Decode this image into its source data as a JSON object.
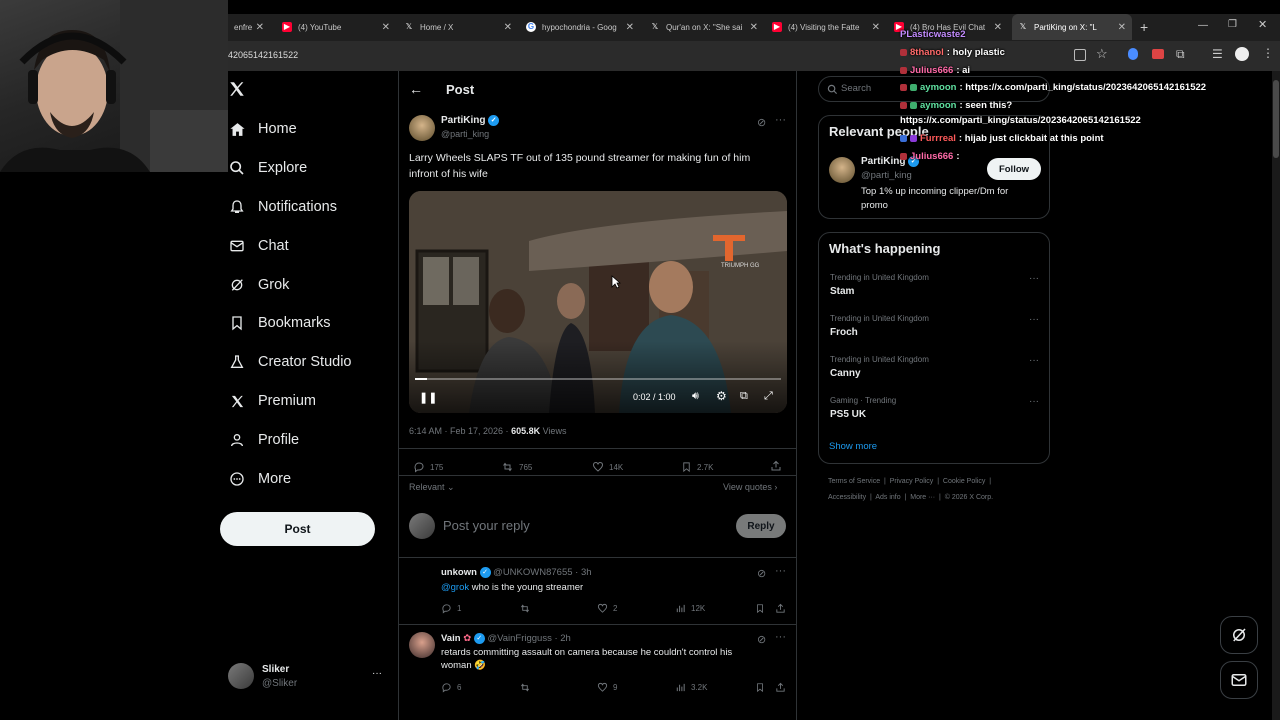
{
  "browser": {
    "tabs": [
      {
        "title": "enfre",
        "icon": "page-icon"
      },
      {
        "title": "(4) YouTube",
        "icon": "youtube-icon"
      },
      {
        "title": "Home / X",
        "icon": "x-logo-icon"
      },
      {
        "title": "hypochondria - Goog",
        "icon": "google-icon"
      },
      {
        "title": "Qur'an on X: \"She sai",
        "icon": "x-logo-icon"
      },
      {
        "title": "(4) Visiting the Fatte",
        "icon": "youtube-icon"
      },
      {
        "title": "(4) Bro Has Evil Chat",
        "icon": "youtube-icon"
      },
      {
        "title": "PartiKing on X: \"L",
        "icon": "x-logo-icon"
      }
    ],
    "new_tab_label": "+",
    "address": "42065142161522"
  },
  "nav": {
    "items": [
      {
        "label": "Home",
        "icon": "home-icon"
      },
      {
        "label": "Explore",
        "icon": "search-icon"
      },
      {
        "label": "Notifications",
        "icon": "bell-icon"
      },
      {
        "label": "Chat",
        "icon": "mail-icon"
      },
      {
        "label": "Grok",
        "icon": "grok-icon"
      },
      {
        "label": "Bookmarks",
        "icon": "bookmark-icon"
      },
      {
        "label": "Creator Studio",
        "icon": "flask-icon"
      },
      {
        "label": "Premium",
        "icon": "x-logo-icon"
      },
      {
        "label": "Profile",
        "icon": "person-icon"
      },
      {
        "label": "More",
        "icon": "more-circle-icon"
      }
    ],
    "post_label": "Post",
    "account": {
      "name": "Sliker",
      "handle": "@Sliker",
      "menu": "···"
    }
  },
  "post": {
    "header_title": "Post",
    "author": {
      "name": "PartiKing",
      "handle": "@parti_king"
    },
    "text_line1": "Larry Wheels SLAPS TF out of 135 pound streamer for making fun of him",
    "text_line2": "infront of his wife",
    "video": {
      "time": "0:02 / 1:00",
      "progress": 0.033,
      "watermark": "TRIUMPH GG"
    },
    "timestamp": "6:14 AM · Feb 17, 2026 · ",
    "views_count": "605.8K",
    "views_label": " Views",
    "stats": {
      "replies": "175",
      "reposts": "765",
      "likes": "14K",
      "bookmarks": "2.7K"
    },
    "sort_label": "Relevant",
    "view_quotes": "View quotes",
    "reply_placeholder": "Post your reply",
    "reply_button": "Reply"
  },
  "replies": [
    {
      "name": "unkown",
      "handle": "@UNKOWN87655 · 3h",
      "mention": "@grok",
      "text": " who is the young streamer",
      "text2": "",
      "replies": "1",
      "reposts": "",
      "likes": "2",
      "views": "12K"
    },
    {
      "name": "Vain",
      "handle": "@VainFrigguss · 2h",
      "mention": "",
      "text": "retards committing assault on camera because he couldn't control his",
      "text2": "woman 🤣",
      "replies": "6",
      "reposts": "",
      "likes": "9",
      "views": "3.2K"
    }
  ],
  "sidebar": {
    "search_placeholder": "Search",
    "relevant_title": "Relevant people",
    "person": {
      "name": "PartiKing",
      "handle": "@parti_king",
      "bio1": "Top 1% up incoming clipper/Dm for",
      "bio2": "promo",
      "follow": "Follow"
    },
    "happening_title": "What's happening",
    "trends": [
      {
        "meta": "Trending in United Kingdom",
        "name": "Stam"
      },
      {
        "meta": "Trending in United Kingdom",
        "name": "Froch"
      },
      {
        "meta": "Trending in United Kingdom",
        "name": "Canny"
      },
      {
        "meta": "Gaming · Trending",
        "name": "PS5 UK"
      }
    ],
    "show_more": "Show more",
    "footer1": [
      "Terms of Service",
      "Privacy Policy",
      "Cookie Policy"
    ],
    "footer2": [
      "Accessibility",
      "Ads info",
      "More ···",
      "© 2026 X Corp."
    ]
  },
  "chat": [
    {
      "user": "PLasticwaste2",
      "color": "#c38cff",
      "msg": ""
    },
    {
      "user": "8thanol",
      "color": "#ff6a6a",
      "msg": ": holy plastic"
    },
    {
      "user": "Julius666",
      "color": "#ff6aa8",
      "msg": ": ai"
    },
    {
      "user": "aymoon",
      "color": "#5fe0a0",
      "msg": ": https://x.com/parti_king/status/2023642065142161522"
    },
    {
      "user": "aymoon",
      "color": "#5fe0a0",
      "msg": ": seen this?"
    },
    {
      "user": "",
      "color": "#ffffff",
      "msg": "https://x.com/parti_king/status/2023642065142161522"
    },
    {
      "user": "Furrreal",
      "color": "#ff5a5a",
      "msg": ": hijab just clickbait at this point"
    },
    {
      "user": "Julius666",
      "color": "#ff6aa8",
      "msg": ":"
    }
  ]
}
